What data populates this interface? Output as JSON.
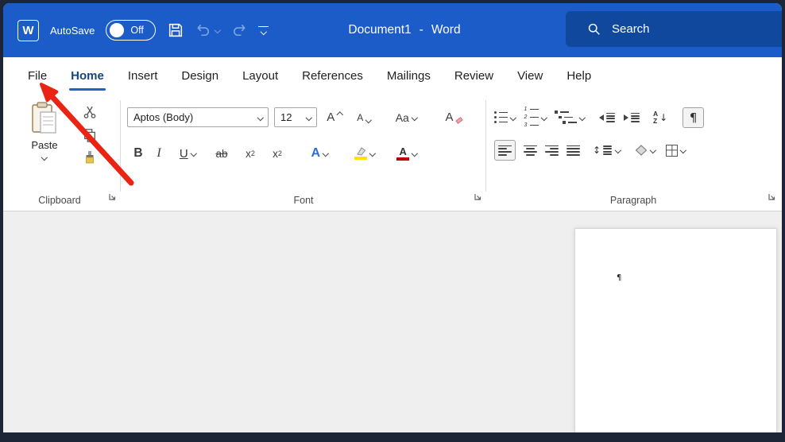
{
  "colors": {
    "titlebar_blue": "#1b5cc8",
    "search_bg": "#10489e",
    "tab_underline": "#2361c2",
    "arrow_red": "#ea2313",
    "highlight_yellow": "#fce300",
    "font_color_red": "#c00000",
    "text_effects_blue": "#2a6fd0"
  },
  "titlebar": {
    "app_icon_letter": "W",
    "autosave_label": "AutoSave",
    "autosave_state": "Off",
    "doc_title": "Document1",
    "separator": "-",
    "app_name": "Word",
    "search_label": "Search"
  },
  "tabs": {
    "selected": "Home",
    "items": [
      {
        "label": "File"
      },
      {
        "label": "Home"
      },
      {
        "label": "Insert"
      },
      {
        "label": "Design"
      },
      {
        "label": "Layout"
      },
      {
        "label": "References"
      },
      {
        "label": "Mailings"
      },
      {
        "label": "Review"
      },
      {
        "label": "View"
      },
      {
        "label": "Help"
      }
    ]
  },
  "ribbon": {
    "clipboard": {
      "group_label": "Clipboard",
      "paste_label": "Paste"
    },
    "font": {
      "group_label": "Font",
      "font_name": "Aptos (Body)",
      "font_size": "12",
      "grow_font": "A",
      "shrink_font": "A",
      "change_case": "Aa",
      "clear_formatting": "A",
      "bold": "B",
      "italic": "I",
      "underline": "U",
      "strikethrough": "ab",
      "sub_base": "x",
      "sub_script": "2",
      "sup_base": "x",
      "sup_script": "2",
      "text_effects": "A",
      "font_color_letter": "A"
    },
    "paragraph": {
      "group_label": "Paragraph",
      "sort_a": "A",
      "sort_z": "Z",
      "sort_arrow": "↓",
      "spacing_arrow": "↕",
      "pilcrow": "¶"
    }
  },
  "document": {
    "caret_mark": "¶"
  }
}
